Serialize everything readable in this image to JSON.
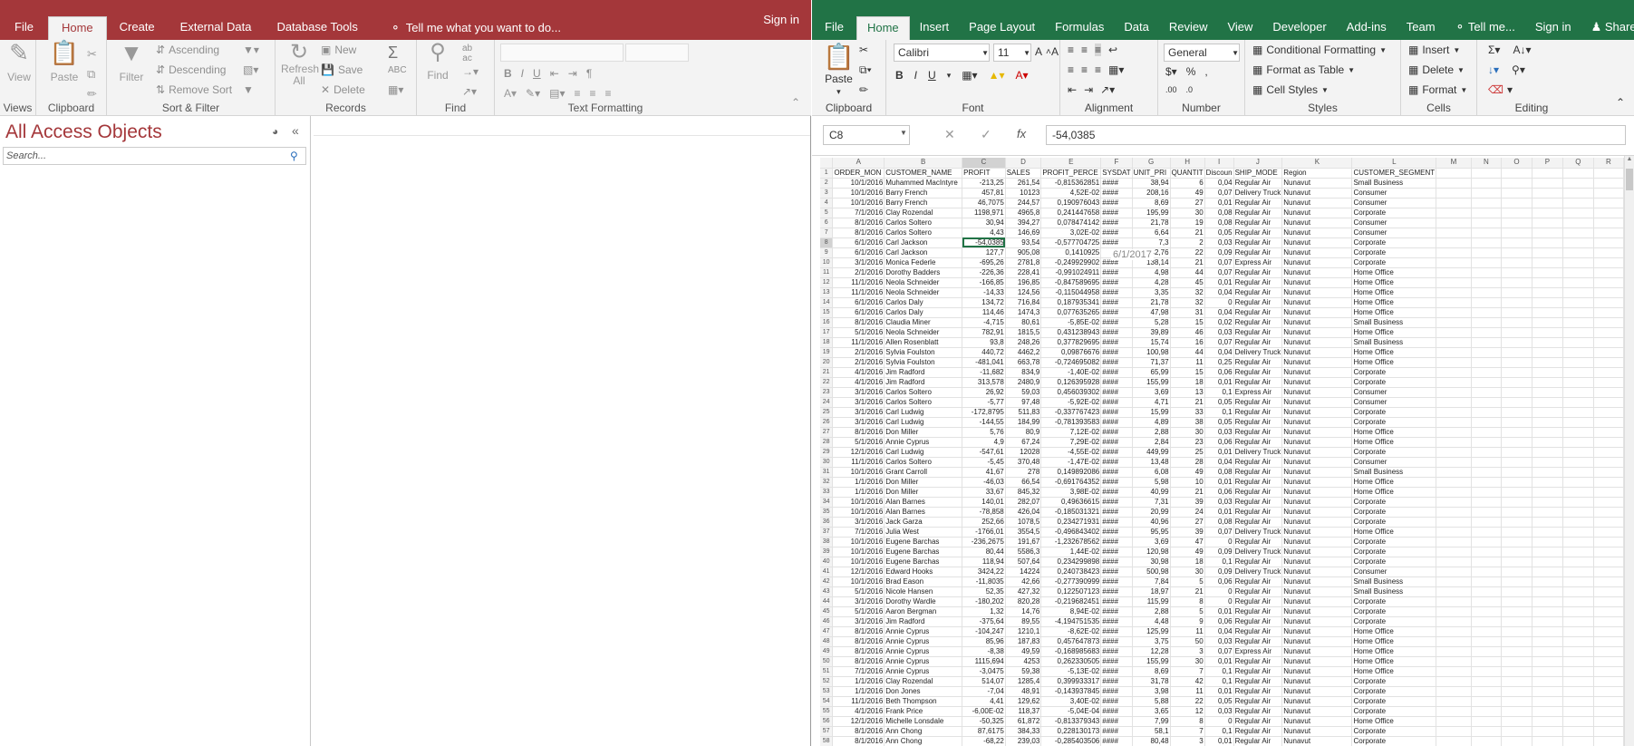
{
  "access": {
    "tabs": [
      "File",
      "Home",
      "Create",
      "External Data",
      "Database Tools"
    ],
    "tell_me": "Tell me what you want to do...",
    "sign_in": "Sign in",
    "groups": {
      "views": {
        "label": "Views",
        "view": "View"
      },
      "clipboard": {
        "label": "Clipboard",
        "paste": "Paste"
      },
      "sort_filter": {
        "label": "Sort & Filter",
        "filter": "Filter",
        "ascending": "Ascending",
        "descending": "Descending",
        "remove_sort": "Remove Sort"
      },
      "records": {
        "label": "Records",
        "refresh": "Refresh All",
        "new": "New",
        "save": "Save",
        "delete": "Delete"
      },
      "find": {
        "label": "Find",
        "find": "Find"
      },
      "text_formatting": {
        "label": "Text Formatting"
      }
    },
    "nav": {
      "title": "All Access Objects",
      "search_placeholder": "Search..."
    }
  },
  "excel": {
    "tabs": [
      "File",
      "Home",
      "Insert",
      "Page Layout",
      "Formulas",
      "Data",
      "Review",
      "View",
      "Developer",
      "Add-ins",
      "Team"
    ],
    "tell_me": "Tell me...",
    "sign_in": "Sign in",
    "share": "Share",
    "ribbon": {
      "clipboard": "Clipboard",
      "paste": "Paste",
      "font": "Font",
      "font_name": "Calibri",
      "font_size": "11",
      "alignment": "Alignment",
      "number": "Number",
      "number_format": "General",
      "styles": "Styles",
      "cond_format": "Conditional Formatting",
      "format_table": "Format as Table",
      "cell_styles": "Cell Styles",
      "cells": "Cells",
      "insert": "Insert",
      "delete": "Delete",
      "format": "Format",
      "editing": "Editing"
    },
    "name_box": "C8",
    "formula": "-54,0385",
    "tooltip": "6/1/2017",
    "columns": [
      "A",
      "B",
      "C",
      "D",
      "E",
      "F",
      "G",
      "H",
      "I",
      "J",
      "K",
      "L",
      "M",
      "N",
      "O",
      "P",
      "Q",
      "R"
    ],
    "headers": [
      "ORDER_MON",
      "CUSTOMER_NAME",
      "PROFIT",
      "SALES",
      "PROFIT_PERCE",
      "SYSDAT",
      "UNIT_PRI",
      "QUANTIT",
      "Discoun",
      "SHIP_MODE",
      "Region",
      "CUSTOMER_SEGMENT"
    ],
    "rows": [
      [
        "10/1/2016",
        "Muhammed MacIntyre",
        "-213,25",
        "261,54",
        "-0,815362851",
        "####",
        "38,94",
        "6",
        "0,04",
        "Regular Air",
        "Nunavut",
        "Small Business"
      ],
      [
        "10/1/2016",
        "Barry French",
        "457,81",
        "10123",
        "4,52E-02",
        "####",
        "208,16",
        "49",
        "0,07",
        "Delivery Truck",
        "Nunavut",
        "Consumer"
      ],
      [
        "10/1/2016",
        "Barry French",
        "46,7075",
        "244,57",
        "0,190976043",
        "####",
        "8,69",
        "27",
        "0,01",
        "Regular Air",
        "Nunavut",
        "Consumer"
      ],
      [
        "7/1/2016",
        "Clay Rozendal",
        "1198,971",
        "4965,8",
        "0,241447658",
        "####",
        "195,99",
        "30",
        "0,08",
        "Regular Air",
        "Nunavut",
        "Corporate"
      ],
      [
        "8/1/2016",
        "Carlos Soltero",
        "30,94",
        "394,27",
        "0,078474142",
        "####",
        "21,78",
        "19",
        "0,08",
        "Regular Air",
        "Nunavut",
        "Consumer"
      ],
      [
        "8/1/2016",
        "Carlos Soltero",
        "4,43",
        "146,69",
        "3,02E-02",
        "####",
        "6,64",
        "21",
        "0,05",
        "Regular Air",
        "Nunavut",
        "Consumer"
      ],
      [
        "6/1/2016",
        "Carl Jackson",
        "-54,0385",
        "93,54",
        "-0,577704725",
        "####",
        "7,3",
        "2",
        "0,03",
        "Regular Air",
        "Nunavut",
        "Corporate"
      ],
      [
        "6/1/2016",
        "Carl Jackson",
        "127,7",
        "905,08",
        "0,1410925",
        "",
        "42,76",
        "22",
        "0,09",
        "Regular Air",
        "Nunavut",
        "Corporate"
      ],
      [
        "3/1/2016",
        "Monica Federle",
        "-695,26",
        "2781,8",
        "-0,249929902",
        "####",
        "138,14",
        "21",
        "0,07",
        "Express Air",
        "Nunavut",
        "Corporate"
      ],
      [
        "2/1/2016",
        "Dorothy Badders",
        "-226,36",
        "228,41",
        "-0,991024911",
        "####",
        "4,98",
        "44",
        "0,07",
        "Regular Air",
        "Nunavut",
        "Home Office"
      ],
      [
        "11/1/2016",
        "Neola Schneider",
        "-166,85",
        "196,85",
        "-0,847589695",
        "####",
        "4,28",
        "45",
        "0,01",
        "Regular Air",
        "Nunavut",
        "Home Office"
      ],
      [
        "11/1/2016",
        "Neola Schneider",
        "-14,33",
        "124,56",
        "-0,115044958",
        "####",
        "3,35",
        "32",
        "0,04",
        "Regular Air",
        "Nunavut",
        "Home Office"
      ],
      [
        "6/1/2016",
        "Carlos Daly",
        "134,72",
        "716,84",
        "0,187935341",
        "####",
        "21,78",
        "32",
        "0",
        "Regular Air",
        "Nunavut",
        "Home Office"
      ],
      [
        "6/1/2016",
        "Carlos Daly",
        "114,46",
        "1474,3",
        "0,077635265",
        "####",
        "47,98",
        "31",
        "0,04",
        "Regular Air",
        "Nunavut",
        "Home Office"
      ],
      [
        "8/1/2016",
        "Claudia Miner",
        "-4,715",
        "80,61",
        "-5,85E-02",
        "####",
        "5,28",
        "15",
        "0,02",
        "Regular Air",
        "Nunavut",
        "Small Business"
      ],
      [
        "5/1/2016",
        "Neola Schneider",
        "782,91",
        "1815,5",
        "0,431238943",
        "####",
        "39,89",
        "46",
        "0,03",
        "Regular Air",
        "Nunavut",
        "Home Office"
      ],
      [
        "11/1/2016",
        "Allen Rosenblatt",
        "93,8",
        "248,26",
        "0,377829695",
        "####",
        "15,74",
        "16",
        "0,07",
        "Regular Air",
        "Nunavut",
        "Small Business"
      ],
      [
        "2/1/2016",
        "Sylvia Foulston",
        "440,72",
        "4462,2",
        "0,09876676",
        "####",
        "100,98",
        "44",
        "0,04",
        "Delivery Truck",
        "Nunavut",
        "Home Office"
      ],
      [
        "2/1/2016",
        "Sylvia Foulston",
        "-481,041",
        "663,78",
        "-0,724695082",
        "####",
        "71,37",
        "11",
        "0,25",
        "Regular Air",
        "Nunavut",
        "Home Office"
      ],
      [
        "4/1/2016",
        "Jim Radford",
        "-11,682",
        "834,9",
        "-1,40E-02",
        "####",
        "65,99",
        "15",
        "0,06",
        "Regular Air",
        "Nunavut",
        "Corporate"
      ],
      [
        "4/1/2016",
        "Jim Radford",
        "313,578",
        "2480,9",
        "0,126395928",
        "####",
        "155,99",
        "18",
        "0,01",
        "Regular Air",
        "Nunavut",
        "Corporate"
      ],
      [
        "3/1/2016",
        "Carlos Soltero",
        "26,92",
        "59,03",
        "0,456039302",
        "####",
        "3,69",
        "13",
        "0,1",
        "Express Air",
        "Nunavut",
        "Consumer"
      ],
      [
        "3/1/2016",
        "Carlos Soltero",
        "-5,77",
        "97,48",
        "-5,92E-02",
        "####",
        "4,71",
        "21",
        "0,05",
        "Regular Air",
        "Nunavut",
        "Consumer"
      ],
      [
        "3/1/2016",
        "Carl Ludwig",
        "-172,8795",
        "511,83",
        "-0,337767423",
        "####",
        "15,99",
        "33",
        "0,1",
        "Regular Air",
        "Nunavut",
        "Corporate"
      ],
      [
        "3/1/2016",
        "Carl Ludwig",
        "-144,55",
        "184,99",
        "-0,781393583",
        "####",
        "4,89",
        "38",
        "0,05",
        "Regular Air",
        "Nunavut",
        "Corporate"
      ],
      [
        "8/1/2016",
        "Don Miller",
        "5,76",
        "80,9",
        "7,12E-02",
        "####",
        "2,88",
        "30",
        "0,03",
        "Regular Air",
        "Nunavut",
        "Home Office"
      ],
      [
        "5/1/2016",
        "Annie Cyprus",
        "4,9",
        "67,24",
        "7,29E-02",
        "####",
        "2,84",
        "23",
        "0,06",
        "Regular Air",
        "Nunavut",
        "Home Office"
      ],
      [
        "12/1/2016",
        "Carl Ludwig",
        "-547,61",
        "12028",
        "-4,55E-02",
        "####",
        "449,99",
        "25",
        "0,01",
        "Delivery Truck",
        "Nunavut",
        "Corporate"
      ],
      [
        "11/1/2016",
        "Carlos Soltero",
        "-5,45",
        "370,48",
        "-1,47E-02",
        "####",
        "13,48",
        "28",
        "0,04",
        "Regular Air",
        "Nunavut",
        "Consumer"
      ],
      [
        "10/1/2016",
        "Grant Carroll",
        "41,67",
        "278",
        "0,149892086",
        "####",
        "6,08",
        "49",
        "0,08",
        "Regular Air",
        "Nunavut",
        "Small Business"
      ],
      [
        "1/1/2016",
        "Don Miller",
        "-46,03",
        "66,54",
        "-0,691764352",
        "####",
        "5,98",
        "10",
        "0,01",
        "Regular Air",
        "Nunavut",
        "Home Office"
      ],
      [
        "1/1/2016",
        "Don Miller",
        "33,67",
        "845,32",
        "3,98E-02",
        "####",
        "40,99",
        "21",
        "0,06",
        "Regular Air",
        "Nunavut",
        "Home Office"
      ],
      [
        "10/1/2016",
        "Alan Barnes",
        "140,01",
        "282,07",
        "0,49636615",
        "####",
        "7,31",
        "39",
        "0,03",
        "Regular Air",
        "Nunavut",
        "Corporate"
      ],
      [
        "10/1/2016",
        "Alan Barnes",
        "-78,858",
        "426,04",
        "-0,185031321",
        "####",
        "20,99",
        "24",
        "0,01",
        "Regular Air",
        "Nunavut",
        "Corporate"
      ],
      [
        "3/1/2016",
        "Jack Garza",
        "252,66",
        "1078,5",
        "0,234271931",
        "####",
        "40,96",
        "27",
        "0,08",
        "Regular Air",
        "Nunavut",
        "Corporate"
      ],
      [
        "7/1/2016",
        "Julia West",
        "-1766,01",
        "3554,5",
        "-0,496843402",
        "####",
        "95,95",
        "39",
        "0,07",
        "Delivery Truck",
        "Nunavut",
        "Home Office"
      ],
      [
        "10/1/2016",
        "Eugene Barchas",
        "-236,2675",
        "191,67",
        "-1,232678562",
        "####",
        "3,69",
        "47",
        "0",
        "Regular Air",
        "Nunavut",
        "Corporate"
      ],
      [
        "10/1/2016",
        "Eugene Barchas",
        "80,44",
        "5586,3",
        "1,44E-02",
        "####",
        "120,98",
        "49",
        "0,09",
        "Delivery Truck",
        "Nunavut",
        "Corporate"
      ],
      [
        "10/1/2016",
        "Eugene Barchas",
        "118,94",
        "507,64",
        "0,234299898",
        "####",
        "30,98",
        "18",
        "0,1",
        "Regular Air",
        "Nunavut",
        "Corporate"
      ],
      [
        "12/1/2016",
        "Edward Hooks",
        "3424,22",
        "14224",
        "0,240738423",
        "####",
        "500,98",
        "30",
        "0,09",
        "Delivery Truck",
        "Nunavut",
        "Consumer"
      ],
      [
        "10/1/2016",
        "Brad Eason",
        "-11,8035",
        "42,66",
        "-0,277390999",
        "####",
        "7,84",
        "5",
        "0,06",
        "Regular Air",
        "Nunavut",
        "Small Business"
      ],
      [
        "5/1/2016",
        "Nicole Hansen",
        "52,35",
        "427,32",
        "0,122507123",
        "####",
        "18,97",
        "21",
        "0",
        "Regular Air",
        "Nunavut",
        "Small Business"
      ],
      [
        "3/1/2016",
        "Dorothy Wardle",
        "-180,202",
        "820,28",
        "-0,219682451",
        "####",
        "115,99",
        "8",
        "0",
        "Regular Air",
        "Nunavut",
        "Corporate"
      ],
      [
        "5/1/2016",
        "Aaron Bergman",
        "1,32",
        "14,76",
        "8,94E-02",
        "####",
        "2,88",
        "5",
        "0,01",
        "Regular Air",
        "Nunavut",
        "Corporate"
      ],
      [
        "3/1/2016",
        "Jim Radford",
        "-375,64",
        "89,55",
        "-4,194751535",
        "####",
        "4,48",
        "9",
        "0,06",
        "Regular Air",
        "Nunavut",
        "Corporate"
      ],
      [
        "8/1/2016",
        "Annie Cyprus",
        "-104,247",
        "1210,1",
        "-8,62E-02",
        "####",
        "125,99",
        "11",
        "0,04",
        "Regular Air",
        "Nunavut",
        "Home Office"
      ],
      [
        "8/1/2016",
        "Annie Cyprus",
        "85,96",
        "187,83",
        "0,457647873",
        "####",
        "3,75",
        "50",
        "0,03",
        "Regular Air",
        "Nunavut",
        "Home Office"
      ],
      [
        "8/1/2016",
        "Annie Cyprus",
        "-8,38",
        "49,59",
        "-0,168985683",
        "####",
        "12,28",
        "3",
        "0,07",
        "Express Air",
        "Nunavut",
        "Home Office"
      ],
      [
        "8/1/2016",
        "Annie Cyprus",
        "1115,694",
        "4253",
        "0,262330505",
        "####",
        "155,99",
        "30",
        "0,01",
        "Regular Air",
        "Nunavut",
        "Home Office"
      ],
      [
        "7/1/2016",
        "Annie Cyprus",
        "-3,0475",
        "59,38",
        "-5,13E-02",
        "####",
        "8,69",
        "7",
        "0,1",
        "Regular Air",
        "Nunavut",
        "Home Office"
      ],
      [
        "1/1/2016",
        "Clay Rozendal",
        "514,07",
        "1285,4",
        "0,399933317",
        "####",
        "31,78",
        "42",
        "0,1",
        "Regular Air",
        "Nunavut",
        "Corporate"
      ],
      [
        "1/1/2016",
        "Don Jones",
        "-7,04",
        "48,91",
        "-0,143937845",
        "####",
        "3,98",
        "11",
        "0,01",
        "Regular Air",
        "Nunavut",
        "Corporate"
      ],
      [
        "11/1/2016",
        "Beth Thompson",
        "4,41",
        "129,62",
        "3,40E-02",
        "####",
        "5,88",
        "22",
        "0,05",
        "Regular Air",
        "Nunavut",
        "Corporate"
      ],
      [
        "4/1/2016",
        "Frank Price",
        "-6,00E-02",
        "118,37",
        "-5,04E-04",
        "####",
        "3,65",
        "12",
        "0,03",
        "Regular Air",
        "Nunavut",
        "Corporate"
      ],
      [
        "12/1/2016",
        "Michelle Lonsdale",
        "-50,325",
        "61,872",
        "-0,813379343",
        "####",
        "7,99",
        "8",
        "0",
        "Regular Air",
        "Nunavut",
        "Home Office"
      ],
      [
        "8/1/2016",
        "Ann Chong",
        "87,6175",
        "384,33",
        "0,228130173",
        "####",
        "58,1",
        "7",
        "0,1",
        "Regular Air",
        "Nunavut",
        "Corporate"
      ],
      [
        "8/1/2016",
        "Ann Chong",
        "-68,22",
        "239,03",
        "-0,285403506",
        "####",
        "80,48",
        "3",
        "0,01",
        "Regular Air",
        "Nunavut",
        "Corporate"
      ]
    ]
  }
}
